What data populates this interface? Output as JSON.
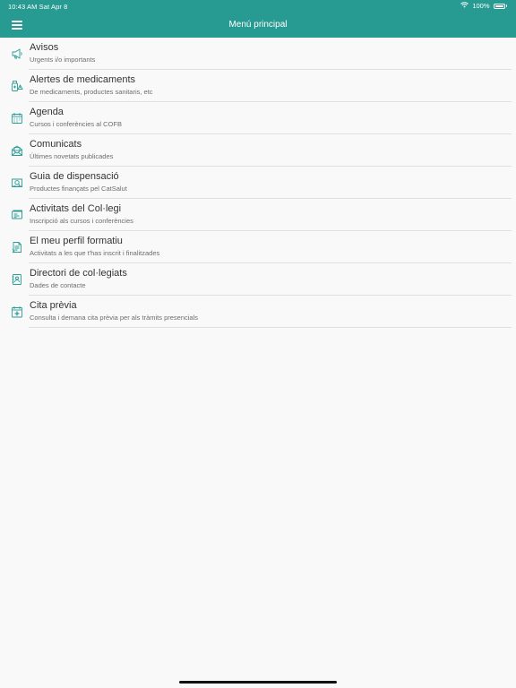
{
  "status": {
    "time_date": "10:43 AM   Sat Apr 8",
    "battery": "100%"
  },
  "header": {
    "title": "Menú principal",
    "menu_icon": "hamburger-icon"
  },
  "colors": {
    "accent": "#279a92",
    "icon": "#2a9d94"
  },
  "menu": [
    {
      "label": "Avisos",
      "subtitle": "Urgents i/o importants",
      "icon": "megaphone-icon"
    },
    {
      "label": "Alertes de medicaments",
      "subtitle": "De medicaments, productes sanitaris, etc",
      "icon": "medicine-alert-icon"
    },
    {
      "label": "Agenda",
      "subtitle": "Cursos i conferències al COFB",
      "icon": "calendar-icon"
    },
    {
      "label": "Comunicats",
      "subtitle": "Últimes novetats publicades",
      "icon": "envelope-icon"
    },
    {
      "label": "Guia de dispensació",
      "subtitle": "Productes finançats pel CatSalut",
      "icon": "guide-book-icon"
    },
    {
      "label": "Activitats del Col·legi",
      "subtitle": "Inscripció als cursos i conferències",
      "icon": "certificate-icon"
    },
    {
      "label": "El meu perfil formatiu",
      "subtitle": "Activitats a les que t'has inscrit i finalitzades",
      "icon": "profile-document-icon"
    },
    {
      "label": "Directori de col·legiats",
      "subtitle": "Dades de contacte",
      "icon": "directory-icon"
    },
    {
      "label": "Cita prèvia",
      "subtitle": "Consulta i demana cita prèvia per als tràmits presencials",
      "icon": "appointment-icon"
    }
  ]
}
